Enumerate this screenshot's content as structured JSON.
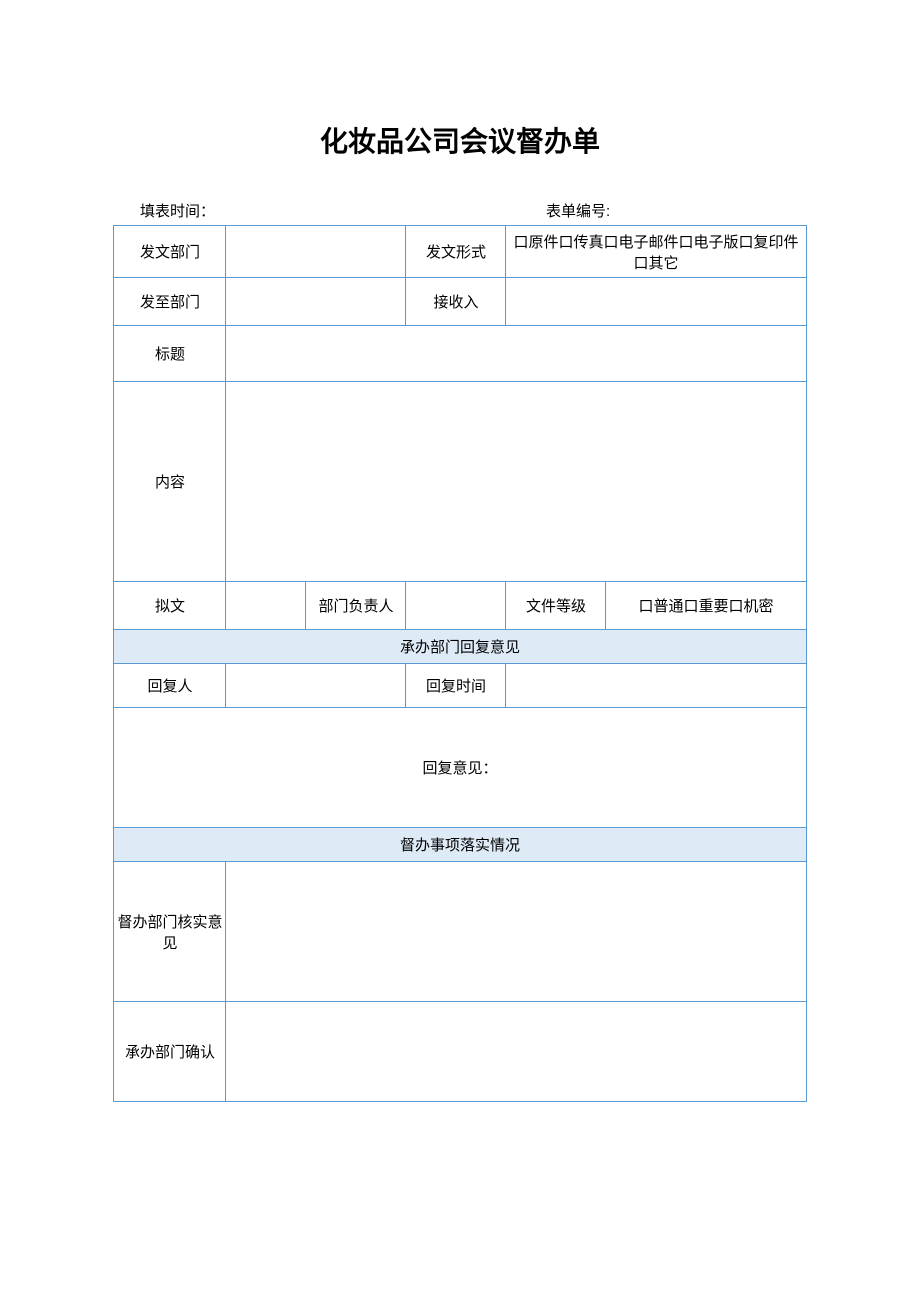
{
  "title": "化妆品公司会议督办单",
  "meta": {
    "fillTimeLabel": "填表时间：",
    "formNoLabel": "表单编号:"
  },
  "rows": {
    "sendDept": "发文部门",
    "sendForm": "发文形式",
    "sendFormOptions": "口原件口传真口电子邮件口电子版口复印件口其它",
    "toDept": "发至部门",
    "receiver": "接收入",
    "subject": "标题",
    "content": "内容",
    "drafter": "拟文",
    "deptHead": "部门负责人",
    "docLevel": "文件等级",
    "docLevelOptions": "口普通口重要口机密",
    "section1": "承办部门回复意见",
    "replier": "回复人",
    "replyTime": "回复时间",
    "replyOpinion": "回复意见：",
    "section2": "督办事项落实情况",
    "superviseVerify": "督办部门核实意见",
    "undertakeConfirm": "承办部门确认"
  }
}
